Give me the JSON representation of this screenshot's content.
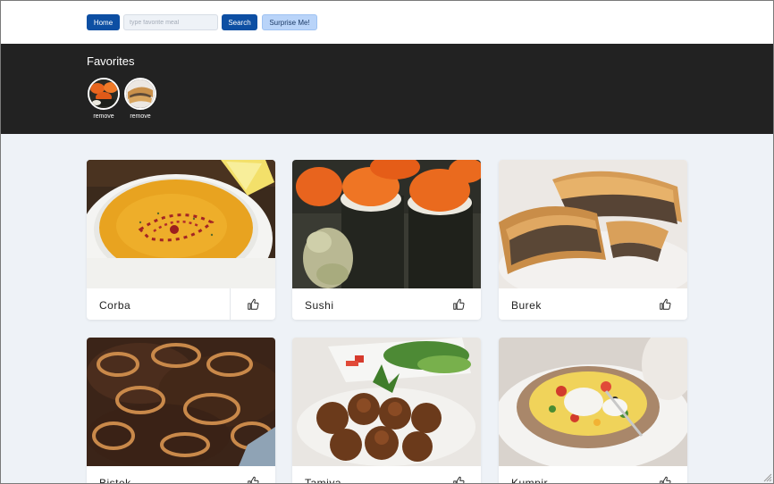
{
  "header": {
    "home_label": "Home",
    "search_placeholder": "type favorite meal",
    "search_label": "Search",
    "surprise_label": "Surprise Me!"
  },
  "favorites": {
    "title": "Favorites",
    "items": [
      {
        "meal": "Sushi",
        "remove_label": "remove"
      },
      {
        "meal": "Burek",
        "remove_label": "remove"
      }
    ]
  },
  "meals": [
    {
      "name": "Corba"
    },
    {
      "name": "Sushi"
    },
    {
      "name": "Burek"
    },
    {
      "name": "Bistek"
    },
    {
      "name": "Tamiya"
    },
    {
      "name": "Kumpir"
    }
  ],
  "icons": {
    "like": "thumbs-up-icon",
    "remove": "remove-link"
  },
  "colors": {
    "primary": "#0d4fa3",
    "secondary": "#b9d4f9",
    "favorites_bg": "#222222",
    "page_bg": "#eef2f7"
  }
}
